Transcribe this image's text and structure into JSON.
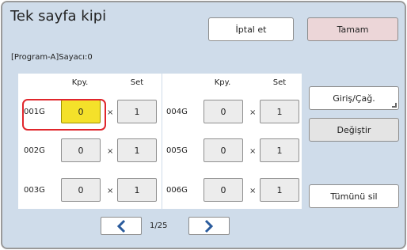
{
  "header": {
    "title": "Tek sayfa kipi",
    "cancel_label": "İptal et",
    "ok_label": "Tamam"
  },
  "counter_text": "[Program-A]Sayacı:0",
  "columns": {
    "copies": "Kpy.",
    "sets": "Set"
  },
  "rows": [
    {
      "label": "001G",
      "copies": "0",
      "sets": "1"
    },
    {
      "label": "002G",
      "copies": "0",
      "sets": "1"
    },
    {
      "label": "003G",
      "copies": "0",
      "sets": "1"
    },
    {
      "label": "004G",
      "copies": "0",
      "sets": "1"
    },
    {
      "label": "005G",
      "copies": "0",
      "sets": "1"
    },
    {
      "label": "006G",
      "copies": "0",
      "sets": "1"
    }
  ],
  "times_symbol": "×",
  "side_buttons": {
    "entry_call": "Giriş/Çağ.",
    "change": "Değiştir",
    "clear_all": "Tümünü sil"
  },
  "pagination": {
    "page_text": "1/25"
  },
  "colors": {
    "background": "#cfdcea",
    "active_cell": "#f4e12a",
    "highlight": "#e0262c",
    "ok_button": "#ecd6d8",
    "arrow": "#2a5b9c"
  },
  "icons": {
    "prev": "chevron-left-icon",
    "next": "chevron-right-icon"
  }
}
